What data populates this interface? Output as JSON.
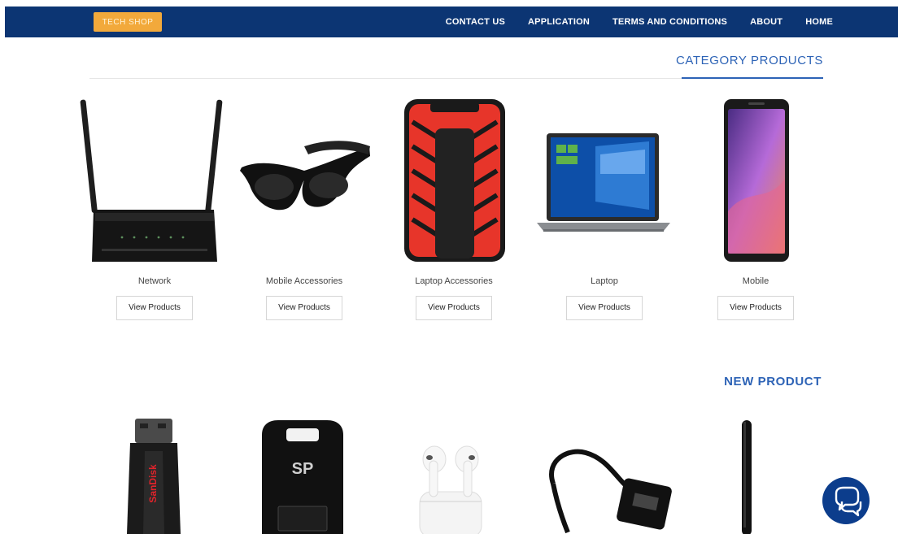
{
  "nav": {
    "logo_text": "TECH SHOP",
    "links": [
      "CONTACT US",
      "APPLICATION",
      "TERMS AND CONDITIONS",
      "ABOUT",
      "HOME"
    ]
  },
  "category_section": {
    "heading": "CATEGORY PRODUCTS",
    "cards": [
      {
        "label": "Network",
        "button": "View Products",
        "icon": "router-icon"
      },
      {
        "label": "Mobile Accessories",
        "button": "View Products",
        "icon": "sunglasses-icon"
      },
      {
        "label": "Laptop Accessories",
        "button": "View Products",
        "icon": "hard-drive-icon"
      },
      {
        "label": "Laptop",
        "button": "View Products",
        "icon": "laptop-icon"
      },
      {
        "label": "Mobile",
        "button": "View Products",
        "icon": "smartphone-icon"
      }
    ]
  },
  "new_section": {
    "heading": "NEW PRODUCT",
    "items": [
      {
        "icon": "usb-drive-icon",
        "brand_text": "SanDisk"
      },
      {
        "icon": "usb-drive-black-icon",
        "brand_text": "SP"
      },
      {
        "icon": "earbuds-icon"
      },
      {
        "icon": "otg-cable-icon"
      },
      {
        "icon": "antenna-icon"
      }
    ]
  },
  "colors": {
    "nav_bg": "#0c3573",
    "accent": "#2d63b6",
    "logo_bg": "#f2a93b",
    "chat_bg": "#0c3d8c"
  },
  "chat": {
    "icon": "chat-icon"
  }
}
